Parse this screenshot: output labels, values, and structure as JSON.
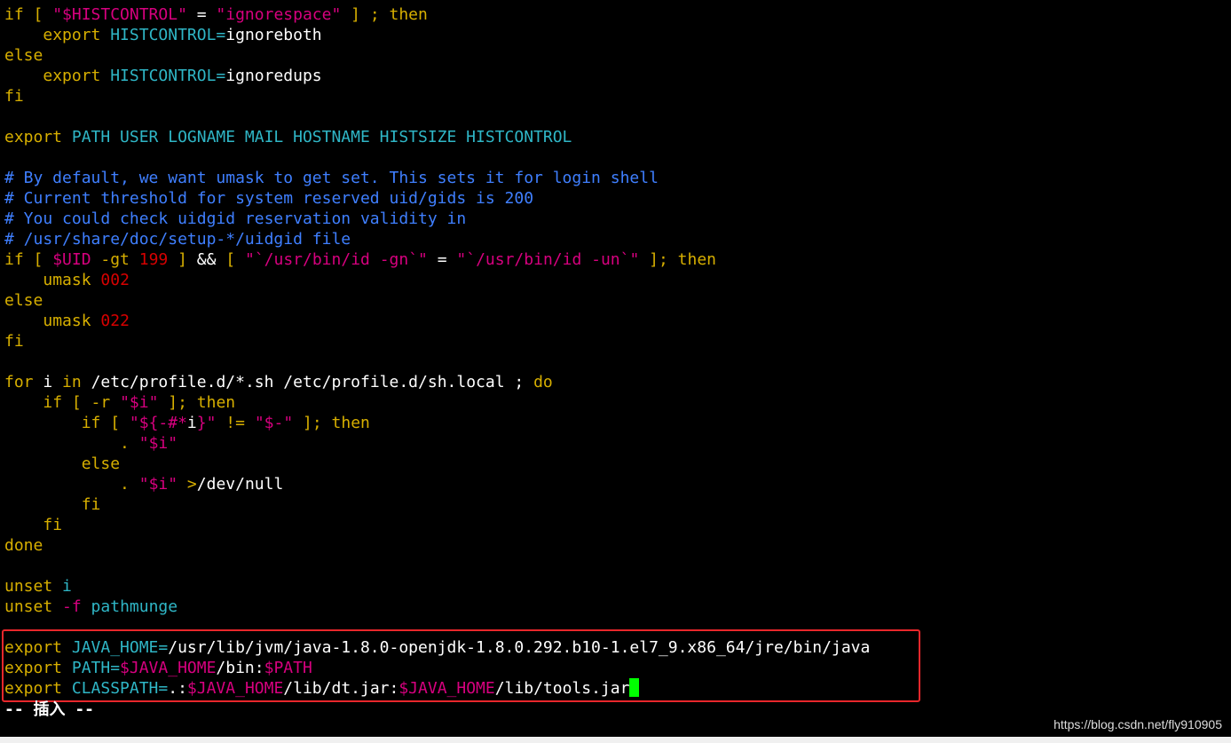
{
  "terminal": {
    "mode": "-- 插入 --",
    "watermark": "https://blog.csdn.net/fly910905",
    "cursor_color": "#00ff00",
    "highlight_color": "#e8272b",
    "lines": [
      [
        [
          "kw",
          "if [ "
        ],
        [
          "str",
          "\"$HISTCONTROL\""
        ],
        [
          "txt",
          " = "
        ],
        [
          "str",
          "\"ignorespace\""
        ],
        [
          "kw",
          " ] ; then"
        ]
      ],
      [
        [
          "txt",
          "    "
        ],
        [
          "kw",
          "export "
        ],
        [
          "var",
          "HISTCONTROL="
        ],
        [
          "txt",
          "ignoreboth"
        ]
      ],
      [
        [
          "kw",
          "else"
        ]
      ],
      [
        [
          "txt",
          "    "
        ],
        [
          "kw",
          "export "
        ],
        [
          "var",
          "HISTCONTROL="
        ],
        [
          "txt",
          "ignoredups"
        ]
      ],
      [
        [
          "kw",
          "fi"
        ]
      ],
      [],
      [
        [
          "kw",
          "export "
        ],
        [
          "var",
          "PATH USER LOGNAME MAIL HOSTNAME HISTSIZE HISTCONTROL"
        ]
      ],
      [],
      [
        [
          "cmt",
          "# By default, we want umask to get set. This sets it for login shell"
        ]
      ],
      [
        [
          "cmt",
          "# Current threshold for system reserved uid/gids is 200"
        ]
      ],
      [
        [
          "cmt",
          "# You could check uidgid reservation validity in"
        ]
      ],
      [
        [
          "cmt",
          "# /usr/share/doc/setup-*/uidgid file"
        ]
      ],
      [
        [
          "kw",
          "if [ "
        ],
        [
          "str",
          "$UID"
        ],
        [
          "kw",
          " -gt "
        ],
        [
          "num",
          "199"
        ],
        [
          "kw",
          " ]"
        ],
        [
          "txt",
          " && "
        ],
        [
          "kw",
          "[ "
        ],
        [
          "str",
          "\"`/usr/bin/id -gn`\""
        ],
        [
          "txt",
          " = "
        ],
        [
          "str",
          "\"`/usr/bin/id -un`\""
        ],
        [
          "kw",
          " ]; then"
        ]
      ],
      [
        [
          "txt",
          "    "
        ],
        [
          "kw",
          "umask "
        ],
        [
          "num",
          "002"
        ]
      ],
      [
        [
          "kw",
          "else"
        ]
      ],
      [
        [
          "txt",
          "    "
        ],
        [
          "kw",
          "umask "
        ],
        [
          "num",
          "022"
        ]
      ],
      [
        [
          "kw",
          "fi"
        ]
      ],
      [],
      [
        [
          "kw",
          "for "
        ],
        [
          "txt",
          "i "
        ],
        [
          "kw",
          "in "
        ],
        [
          "txt",
          "/etc/profile.d/*.sh /etc/profile.d/sh.local ; "
        ],
        [
          "kw",
          "do"
        ]
      ],
      [
        [
          "txt",
          "    "
        ],
        [
          "kw",
          "if [ -r "
        ],
        [
          "str",
          "\"$i\""
        ],
        [
          "kw",
          " ]; then"
        ]
      ],
      [
        [
          "txt",
          "        "
        ],
        [
          "kw",
          "if [ "
        ],
        [
          "str",
          "\"${-#*"
        ],
        [
          "txt",
          "i"
        ],
        [
          "str",
          "}\""
        ],
        [
          "kw",
          " != "
        ],
        [
          "str",
          "\"$-\""
        ],
        [
          "kw",
          " ]; then"
        ]
      ],
      [
        [
          "txt",
          "            "
        ],
        [
          "kw",
          ". "
        ],
        [
          "str",
          "\"$i\""
        ]
      ],
      [
        [
          "txt",
          "        "
        ],
        [
          "kw",
          "else"
        ]
      ],
      [
        [
          "txt",
          "            "
        ],
        [
          "kw",
          ". "
        ],
        [
          "str",
          "\"$i\""
        ],
        [
          "kw",
          " >"
        ],
        [
          "txt",
          "/dev/null"
        ]
      ],
      [
        [
          "txt",
          "        "
        ],
        [
          "kw",
          "fi"
        ]
      ],
      [
        [
          "txt",
          "    "
        ],
        [
          "kw",
          "fi"
        ]
      ],
      [
        [
          "kw",
          "done"
        ]
      ],
      [],
      [
        [
          "kw",
          "unset "
        ],
        [
          "var",
          "i"
        ]
      ],
      [
        [
          "kw",
          "unset "
        ],
        [
          "str",
          "-f"
        ],
        [
          "var",
          " pathmunge"
        ]
      ],
      [],
      [
        [
          "kw",
          "export "
        ],
        [
          "var",
          "JAVA_HOME="
        ],
        [
          "txt",
          "/usr/lib/jvm/java-1.8.0-openjdk-1.8.0.292.b10-1.el7_9.x86_64/jre/bin/java"
        ]
      ],
      [
        [
          "kw",
          "export "
        ],
        [
          "var",
          "PATH="
        ],
        [
          "str",
          "$JAVA_HOME"
        ],
        [
          "txt",
          "/bin:"
        ],
        [
          "str",
          "$PATH"
        ]
      ],
      [
        [
          "kw",
          "export "
        ],
        [
          "var",
          "CLASSPATH="
        ],
        [
          "txt",
          ".:"
        ],
        [
          "str",
          "$JAVA_HOME"
        ],
        [
          "txt",
          "/lib/dt.jar:"
        ],
        [
          "str",
          "$JAVA_HOME"
        ],
        [
          "txt",
          "/lib/tools.jar"
        ]
      ]
    ]
  }
}
